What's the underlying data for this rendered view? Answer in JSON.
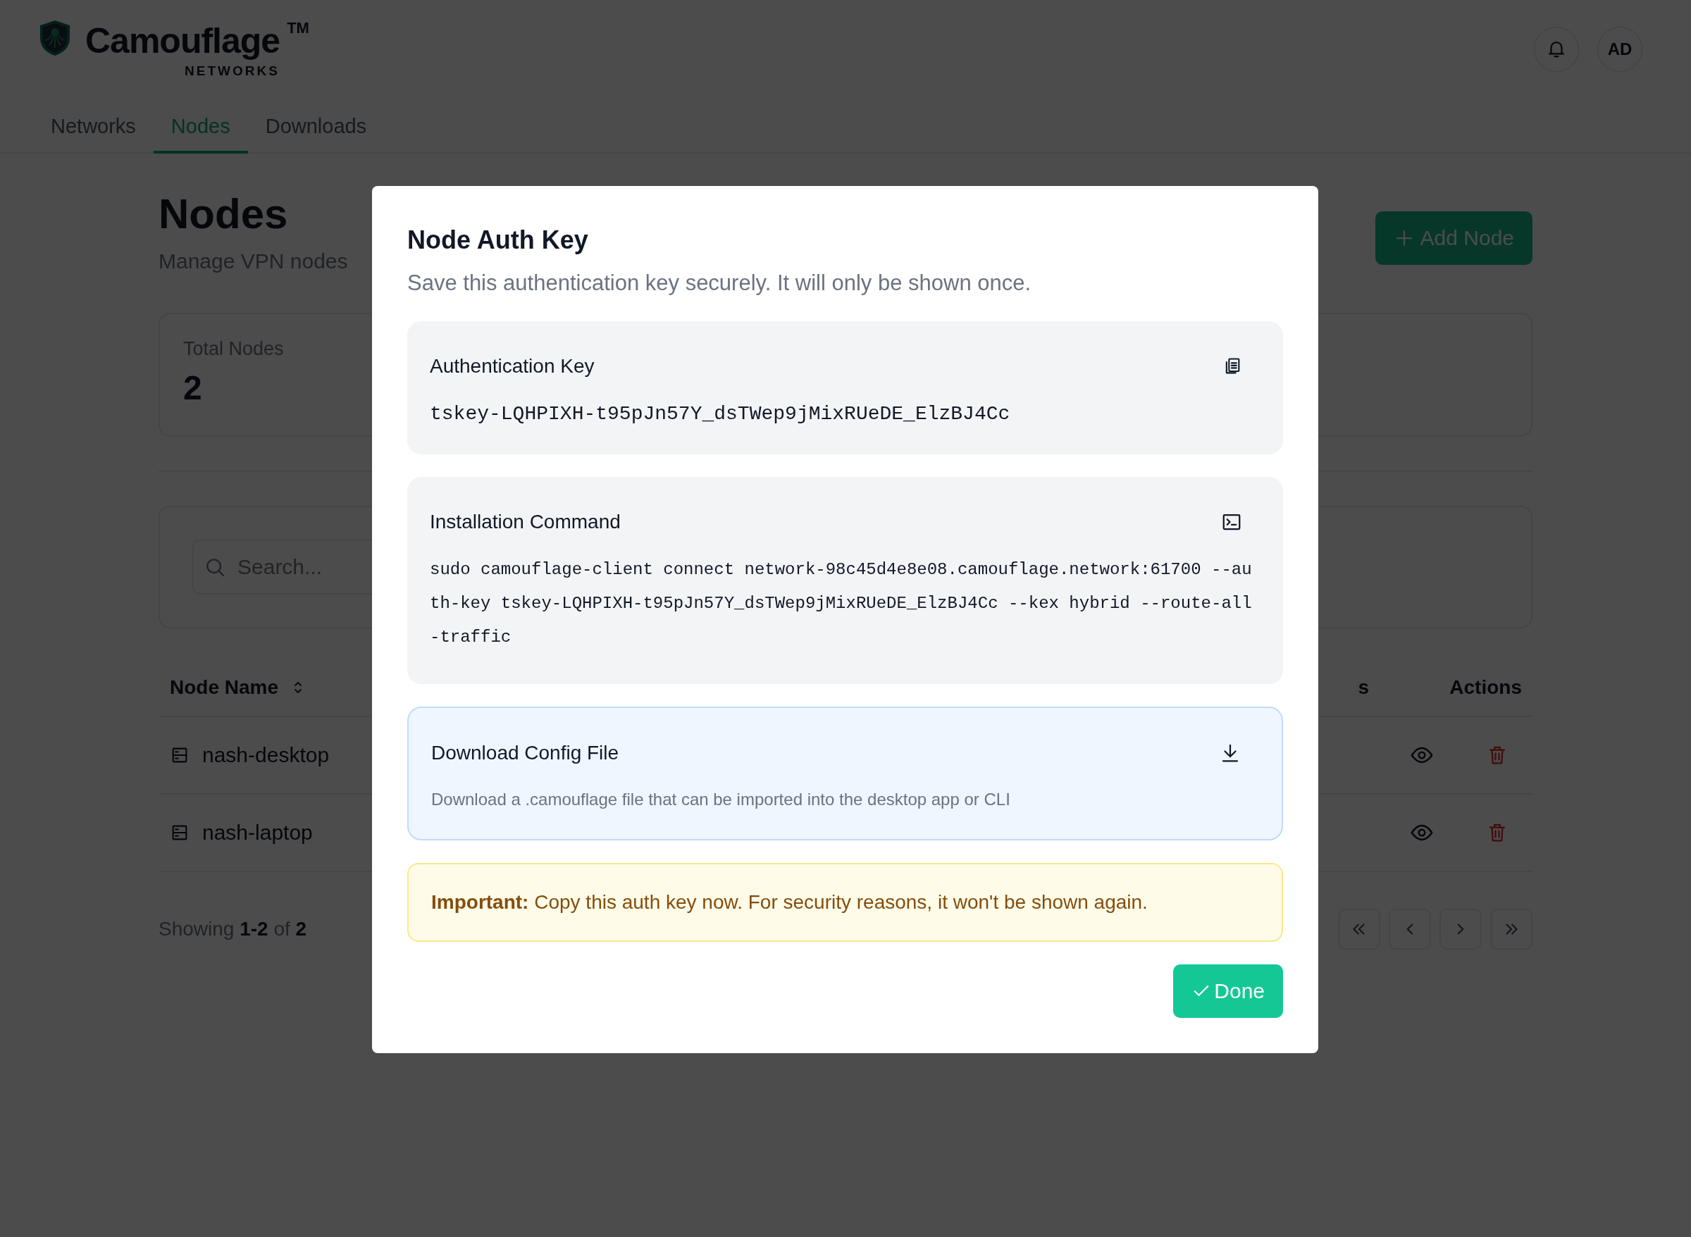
{
  "header": {
    "brand": "Camouflage",
    "trademark": "TM",
    "subtitle": "NETWORKS",
    "avatar": "AD"
  },
  "tabs": [
    {
      "label": "Networks",
      "selected": false
    },
    {
      "label": "Nodes",
      "selected": true
    },
    {
      "label": "Downloads",
      "selected": false
    }
  ],
  "page": {
    "title": "Nodes",
    "subtitle": "Manage VPN nodes",
    "add_button": "Add Node"
  },
  "stats": [
    {
      "label": "Total Nodes",
      "value": "2"
    }
  ],
  "search": {
    "placeholder": "Search..."
  },
  "table": {
    "columns": [
      "Node Name",
      "s",
      "Actions"
    ],
    "rows": [
      {
        "name": "nash-desktop"
      },
      {
        "name": "nash-laptop"
      }
    ]
  },
  "pagination": {
    "summary": "Showing **1-2** of **2**"
  },
  "modal": {
    "title": "Node Auth Key",
    "description": "Save this authentication key securely. It will only be shown once.",
    "cards": [
      {
        "kind": "key",
        "label": "Authentication Key",
        "value": "tskey-LQHPIXH-t95pJn57Y_dsTWep9jMixRUeDE_ElzBJ4Cc"
      },
      {
        "kind": "command",
        "label": "Installation Command",
        "value": "sudo camouflage-client connect network-98c45d4e8e08.camouflage.network:61700 --auth-key tskey-LQHPIXH-t95pJn57Y_dsTWep9jMixRUeDE_ElzBJ4Cc --kex hybrid --route-all-traffic"
      },
      {
        "kind": "download",
        "label": "Download Config File",
        "description": "Download a .camouflage file that can be imported into the desktop app or CLI"
      }
    ],
    "notice": "**Important:** Copy this auth key now. For security reasons, it won't be shown again.",
    "done_button": "Done"
  }
}
